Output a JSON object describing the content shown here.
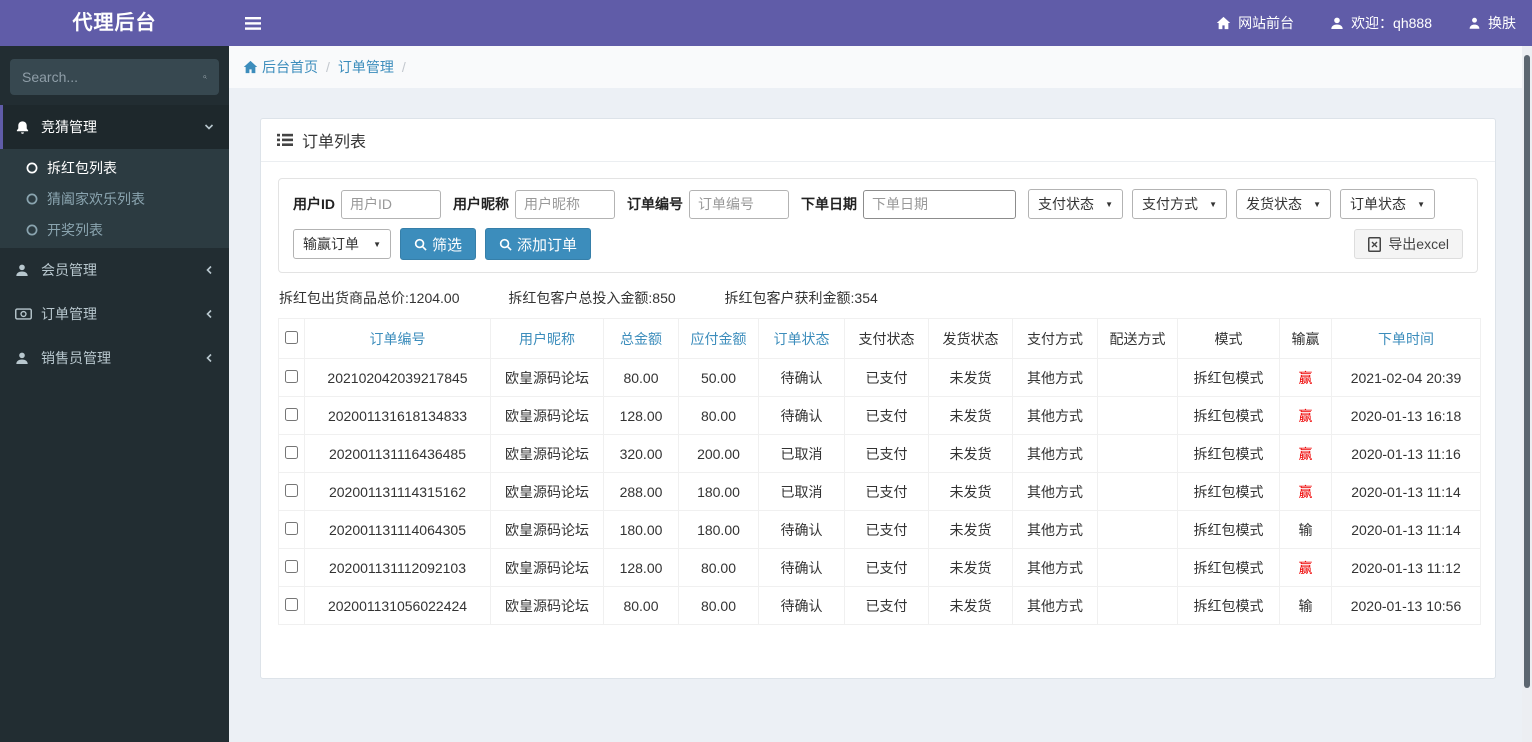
{
  "brand": {
    "title": "代理后台"
  },
  "navbar": {
    "front_site": "网站前台",
    "welcome": "欢迎：qh888",
    "skin": "换肤"
  },
  "sidebar": {
    "search_placeholder": "Search...",
    "menu": [
      {
        "label": "竞猜管理",
        "children": [
          "拆红包列表",
          "猜阖家欢乐列表",
          "开奖列表"
        ]
      },
      {
        "label": "会员管理"
      },
      {
        "label": "订单管理"
      },
      {
        "label": "销售员管理"
      }
    ]
  },
  "breadcrumb": {
    "home": "后台首页",
    "current": "订单管理",
    "separator": "/"
  },
  "panel": {
    "title": "订单列表"
  },
  "filters": {
    "user_id": {
      "label": "用户ID",
      "placeholder": "用户ID",
      "value": ""
    },
    "nickname": {
      "label": "用户昵称",
      "placeholder": "用户昵称",
      "value": ""
    },
    "order_no": {
      "label": "订单编号",
      "placeholder": "订单编号",
      "value": ""
    },
    "order_date": {
      "label": "下单日期",
      "placeholder": "下单日期",
      "value": ""
    },
    "selects": {
      "pay_status": "支付状态",
      "pay_method": "支付方式",
      "ship_status": "发货状态",
      "order_status": "订单状态",
      "win_lose": "输赢订单"
    },
    "buttons": {
      "filter": "筛选",
      "add": "添加订单",
      "export": "导出excel"
    }
  },
  "summary": {
    "total_goods": "拆红包出货商品总价:1204.00",
    "total_invest": "拆红包客户总投入金额:850",
    "total_profit": "拆红包客户获利金额:354"
  },
  "table": {
    "columns": [
      {
        "key": "order_no",
        "label": "订单编号",
        "link": true
      },
      {
        "key": "nickname",
        "label": "用户昵称",
        "link": true
      },
      {
        "key": "total",
        "label": "总金额",
        "link": true
      },
      {
        "key": "payable",
        "label": "应付金额",
        "link": true
      },
      {
        "key": "order_status",
        "label": "订单状态",
        "link": true
      },
      {
        "key": "pay_status",
        "label": "支付状态",
        "link": false
      },
      {
        "key": "ship_status",
        "label": "发货状态",
        "link": false
      },
      {
        "key": "pay_method",
        "label": "支付方式",
        "link": false
      },
      {
        "key": "delivery",
        "label": "配送方式",
        "link": false
      },
      {
        "key": "mode",
        "label": "模式",
        "link": false
      },
      {
        "key": "win",
        "label": "输赢",
        "link": false
      },
      {
        "key": "time",
        "label": "下单时间",
        "link": true
      }
    ],
    "rows": [
      {
        "order_no": "202102042039217845",
        "nickname": "欧皇源码论坛",
        "total": "80.00",
        "payable": "50.00",
        "order_status": "待确认",
        "pay_status": "已支付",
        "ship_status": "未发货",
        "pay_method": "其他方式",
        "delivery": "",
        "mode": "拆红包模式",
        "win": "赢",
        "win_red": true,
        "time": "2021-02-04 20:39"
      },
      {
        "order_no": "202001131618134833",
        "nickname": "欧皇源码论坛",
        "total": "128.00",
        "payable": "80.00",
        "order_status": "待确认",
        "pay_status": "已支付",
        "ship_status": "未发货",
        "pay_method": "其他方式",
        "delivery": "",
        "mode": "拆红包模式",
        "win": "赢",
        "win_red": true,
        "time": "2020-01-13 16:18"
      },
      {
        "order_no": "202001131116436485",
        "nickname": "欧皇源码论坛",
        "total": "320.00",
        "payable": "200.00",
        "order_status": "已取消",
        "pay_status": "已支付",
        "ship_status": "未发货",
        "pay_method": "其他方式",
        "delivery": "",
        "mode": "拆红包模式",
        "win": "赢",
        "win_red": true,
        "time": "2020-01-13 11:16"
      },
      {
        "order_no": "202001131114315162",
        "nickname": "欧皇源码论坛",
        "total": "288.00",
        "payable": "180.00",
        "order_status": "已取消",
        "pay_status": "已支付",
        "ship_status": "未发货",
        "pay_method": "其他方式",
        "delivery": "",
        "mode": "拆红包模式",
        "win": "赢",
        "win_red": true,
        "time": "2020-01-13 11:14"
      },
      {
        "order_no": "202001131114064305",
        "nickname": "欧皇源码论坛",
        "total": "180.00",
        "payable": "180.00",
        "order_status": "待确认",
        "pay_status": "已支付",
        "ship_status": "未发货",
        "pay_method": "其他方式",
        "delivery": "",
        "mode": "拆红包模式",
        "win": "输",
        "win_red": false,
        "time": "2020-01-13 11:14"
      },
      {
        "order_no": "202001131112092103",
        "nickname": "欧皇源码论坛",
        "total": "128.00",
        "payable": "80.00",
        "order_status": "待确认",
        "pay_status": "已支付",
        "ship_status": "未发货",
        "pay_method": "其他方式",
        "delivery": "",
        "mode": "拆红包模式",
        "win": "赢",
        "win_red": true,
        "time": "2020-01-13 11:12"
      },
      {
        "order_no": "202001131056022424",
        "nickname": "欧皇源码论坛",
        "total": "80.00",
        "payable": "80.00",
        "order_status": "待确认",
        "pay_status": "已支付",
        "ship_status": "未发货",
        "pay_method": "其他方式",
        "delivery": "",
        "mode": "拆红包模式",
        "win": "输",
        "win_red": false,
        "time": "2020-01-13 10:56"
      }
    ]
  },
  "colors": {
    "accent": "#605ca8",
    "link": "#3c8dbc",
    "win_red": "#ee0000",
    "sidebar": "#222d32"
  }
}
